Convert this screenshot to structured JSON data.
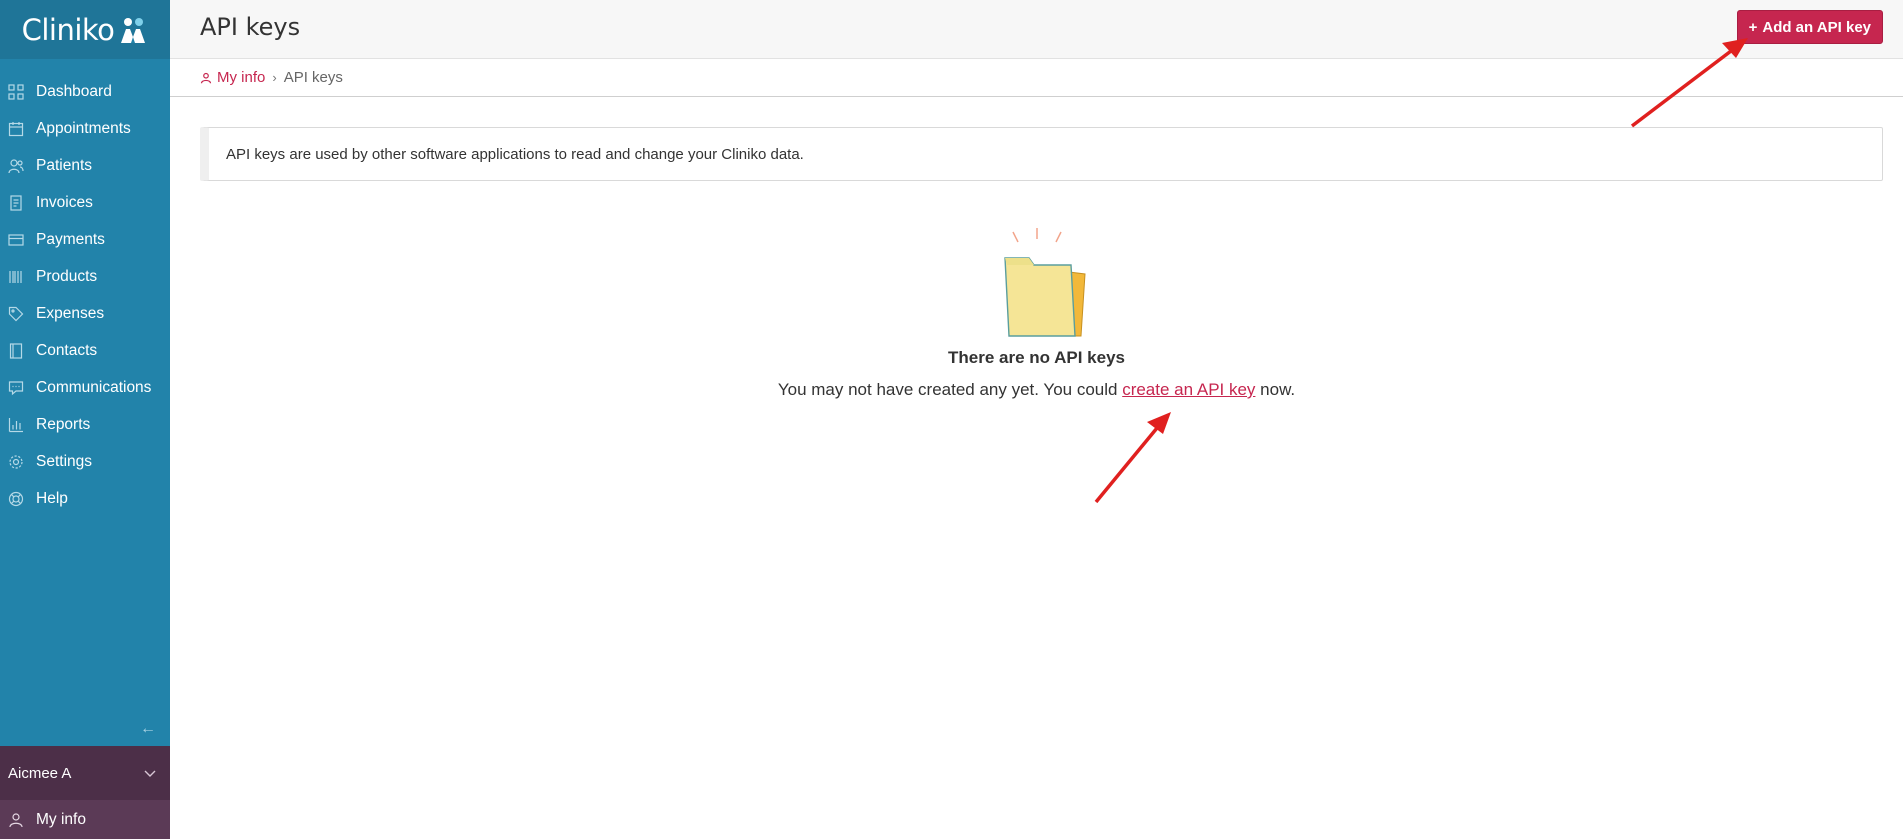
{
  "app": {
    "logo_text": "Cliniko"
  },
  "sidebar": {
    "items": [
      {
        "label": "Dashboard",
        "icon": "dashboard-icon"
      },
      {
        "label": "Appointments",
        "icon": "calendar-icon"
      },
      {
        "label": "Patients",
        "icon": "patients-icon"
      },
      {
        "label": "Invoices",
        "icon": "invoice-icon"
      },
      {
        "label": "Payments",
        "icon": "card-icon"
      },
      {
        "label": "Products",
        "icon": "barcode-icon"
      },
      {
        "label": "Expenses",
        "icon": "tag-icon"
      },
      {
        "label": "Contacts",
        "icon": "contacts-icon"
      },
      {
        "label": "Communications",
        "icon": "chat-icon"
      },
      {
        "label": "Reports",
        "icon": "chart-icon"
      },
      {
        "label": "Settings",
        "icon": "gear-icon"
      },
      {
        "label": "Help",
        "icon": "lifebuoy-icon"
      }
    ],
    "user_name": "Aicmee A",
    "my_info_label": "My info"
  },
  "header": {
    "title": "API keys",
    "add_button_label": "Add an API key"
  },
  "breadcrumb": {
    "parent": "My info",
    "current": "API keys"
  },
  "info": {
    "text": "API keys are used by other software applications to read and change your Cliniko data."
  },
  "empty_state": {
    "title": "There are no API keys",
    "text_before": "You may not have created any yet. You could ",
    "link_text": "create an API key",
    "text_after": " now."
  },
  "colors": {
    "sidebar": "#2283aa",
    "accent": "#c6264f",
    "user_bar": "#4c2f48",
    "annotation": "#e0201f"
  }
}
